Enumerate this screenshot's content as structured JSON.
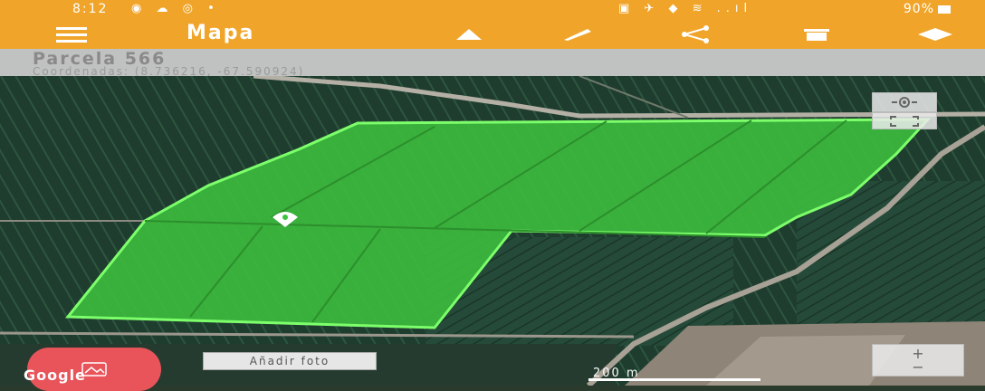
{
  "status_bar": {
    "time": "8:12",
    "battery": "90%",
    "left_icons": "◉ ☁ ◎ •",
    "right_icons": "▣ ✈ ◆ ≋ ..ıl"
  },
  "toolbar": {
    "title": "Mapa",
    "menu_icon": "menu-icon",
    "actions": [
      {
        "name": "navigate-up-icon",
        "glyph": "▲"
      },
      {
        "name": "pencil-icon",
        "glyph": "✎"
      },
      {
        "name": "share-icon",
        "glyph": "<"
      },
      {
        "name": "delete-icon",
        "glyph": "▬"
      },
      {
        "name": "layers-icon",
        "glyph": "◆"
      }
    ]
  },
  "parcel": {
    "title": "Parcela 566",
    "coords": "Coordenadas: (8.736216, -67.590924)"
  },
  "map": {
    "attribution": "Google",
    "scale_label": "200 m",
    "parcel_fill_color": "#3ec33e",
    "parcel_border_color": "#7dff6b"
  },
  "buttons": {
    "add_photo": "Añadir foto",
    "fab_icon": "photo-icon",
    "locate_icon": "my-location-icon",
    "fullscreen_icon": "fullscreen-icon",
    "zoom_in": "+",
    "zoom_out": "−"
  },
  "colors": {
    "accent": "#f0a52a"
  }
}
